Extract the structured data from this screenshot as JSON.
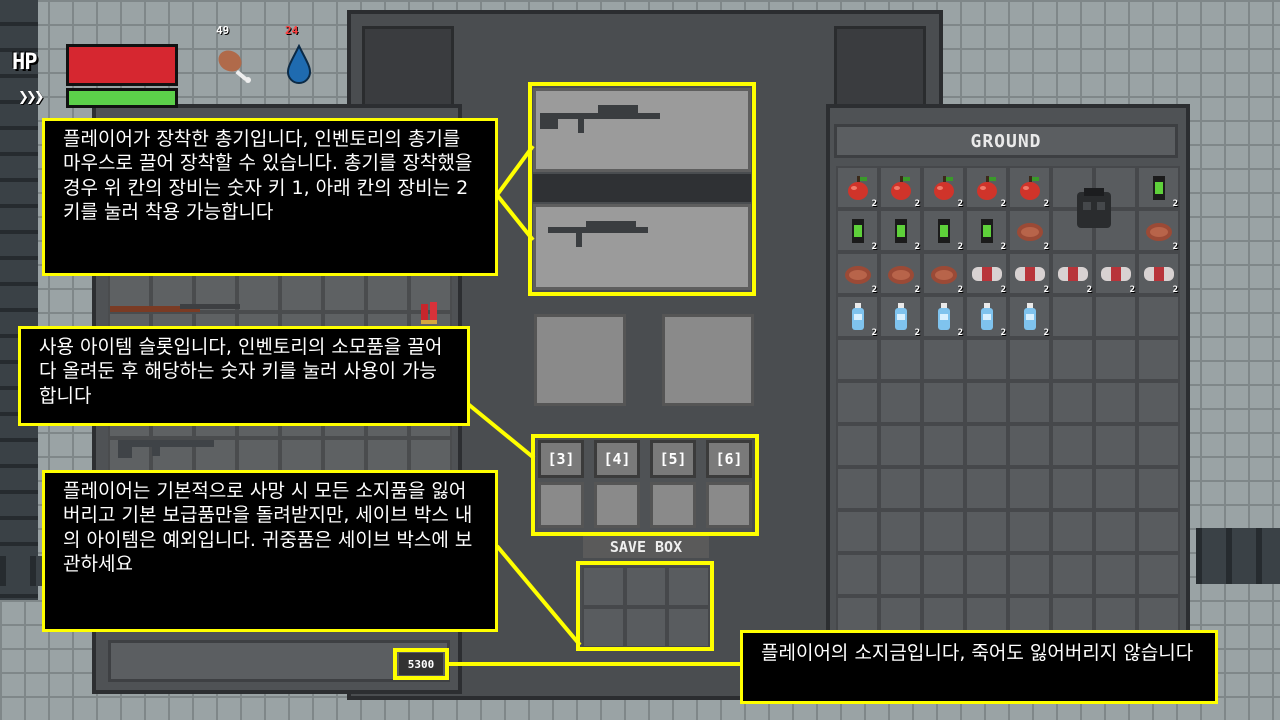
{
  "hud": {
    "hp_label": "HP",
    "stamina_icon": "chevron-triple-icon",
    "hunger_value": "49",
    "thirst_value": "24",
    "hp_fraction": 1.0,
    "stamina_fraction": 1.0,
    "colors": {
      "hp": "#d62730",
      "stamina": "#5cd04a",
      "thirst_value": "#ff4040"
    }
  },
  "equipment": {
    "weapon_slot_1": "rifle-icon",
    "weapon_slot_2": "smg-icon"
  },
  "quick_slots": [
    "[3]",
    "[4]",
    "[5]",
    "[6]"
  ],
  "save_box": {
    "label": "SAVE BOX"
  },
  "money": {
    "amount": "5300"
  },
  "ground": {
    "title": "GROUND",
    "items": [
      {
        "icon": "apple-icon",
        "qty": "2"
      },
      {
        "icon": "apple-icon",
        "qty": "2"
      },
      {
        "icon": "apple-icon",
        "qty": "2"
      },
      {
        "icon": "apple-icon",
        "qty": "2"
      },
      {
        "icon": "apple-icon",
        "qty": "2"
      },
      {
        "icon": "vest-icon",
        "qty": ""
      },
      {
        "icon": "energy-drink-icon",
        "qty": "2"
      },
      {
        "icon": "energy-drink-icon",
        "qty": "2"
      },
      {
        "icon": "energy-drink-icon",
        "qty": "2"
      },
      {
        "icon": "energy-drink-icon",
        "qty": "2"
      },
      {
        "icon": "energy-drink-icon",
        "qty": "2"
      },
      {
        "icon": "steak-icon",
        "qty": "2"
      },
      {
        "icon": "steak-icon",
        "qty": "2"
      },
      {
        "icon": "steak-icon",
        "qty": "2"
      },
      {
        "icon": "steak-icon",
        "qty": "2"
      },
      {
        "icon": "steak-icon",
        "qty": "2"
      },
      {
        "icon": "canned-food-icon",
        "qty": "2"
      },
      {
        "icon": "canned-food-icon",
        "qty": "2"
      },
      {
        "icon": "canned-food-icon",
        "qty": "2"
      },
      {
        "icon": "canned-food-icon",
        "qty": "2"
      },
      {
        "icon": "canned-food-icon",
        "qty": "2"
      },
      {
        "icon": "water-bottle-icon",
        "qty": "2"
      },
      {
        "icon": "water-bottle-icon",
        "qty": "2"
      },
      {
        "icon": "water-bottle-icon",
        "qty": "2"
      },
      {
        "icon": "water-bottle-icon",
        "qty": "2"
      },
      {
        "icon": "water-bottle-icon",
        "qty": "2"
      }
    ]
  },
  "tutorial": {
    "weapon_text": "플레이어가 장착한 총기입니다, 인벤토리의 총기를 마우스로 끌어 장착할 수 있습니다. 총기를 장착했을 경우 위 칸의 장비는 숫자 키 1, 아래 칸의 장비는 2 키를 눌러 착용 가능합니다",
    "quick_slot_text": "사용 아이템 슬롯입니다, 인벤토리의 소모품을 끌어다 올려둔 후 해당하는 숫자 키를 눌러 사용이 가능합니다",
    "save_box_text": "플레이어는 기본적으로 사망 시 모든 소지품을 잃어버리고 기본 보급품만을 돌려받지만, 세이브 박스 내의 아이템은 예외입니다. 귀중품은 세이브 박스에 보관하세요",
    "money_text": "플레이어의 소지금입니다, 죽어도 잃어버리지 않습니다"
  },
  "colors": {
    "highlight": "#ffff00",
    "callout_bg": "#000000"
  }
}
